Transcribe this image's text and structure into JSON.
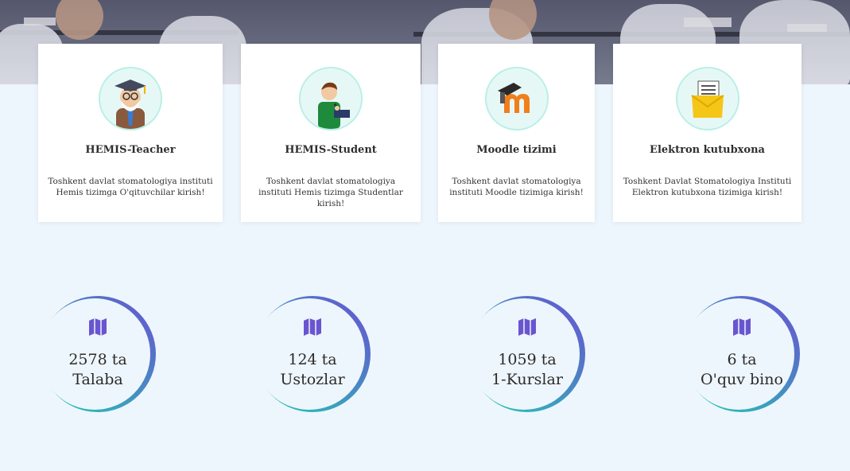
{
  "cards": [
    {
      "title": "HEMIS-Teacher",
      "description": "Toshkent davlat stomatologiya instituti Hemis tizimga O'qituvchilar kirish!",
      "icon": "teacher-icon"
    },
    {
      "title": "HEMIS-Student",
      "description": "Toshkent davlat stomatologiya instituti Hemis tizimga Studentlar kirish!",
      "icon": "student-icon"
    },
    {
      "title": "Moodle tizimi",
      "description": "Toshkent davlat stomatologiya instituti Moodle tizimiga kirish!",
      "icon": "moodle-icon"
    },
    {
      "title": "Elektron kutubxona",
      "description": "Toshkent Davlat Stomatologiya Instituti Elektron kutubxona tizimiga kirish!",
      "icon": "library-folder-icon"
    }
  ],
  "stats": [
    {
      "count": "2578 ta",
      "label": "Talaba",
      "icon": "map-icon"
    },
    {
      "count": "124 ta",
      "label": "Ustozlar",
      "icon": "map-icon"
    },
    {
      "count": "1059 ta",
      "label": "1-Kurslar",
      "icon": "map-icon"
    },
    {
      "count": "6 ta",
      "label": "O'quv bino",
      "icon": "map-icon"
    }
  ],
  "colors": {
    "page_background": "#eef6fd",
    "ring_gradient_start": "#1fd1b0",
    "ring_gradient_end": "#6a4fd3",
    "icon_purple": "#6a55d0",
    "moodle_orange": "#f07f1b"
  }
}
